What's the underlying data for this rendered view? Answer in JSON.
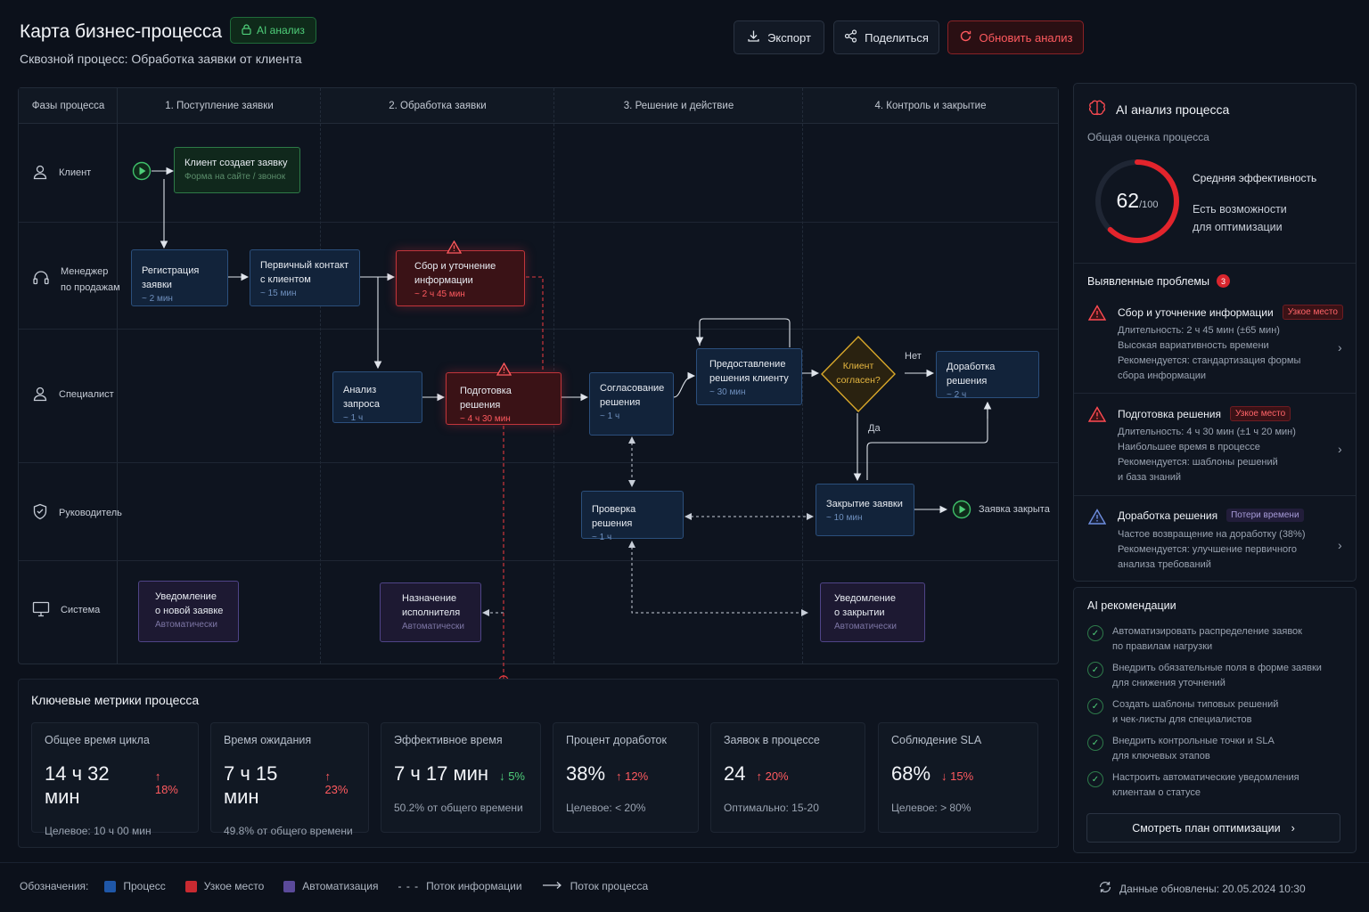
{
  "header": {
    "title": "Карта бизнес-процесса",
    "badge": "AI анализ",
    "subtitle": "Сквозной процесс: Обработка заявки от клиента",
    "export": "Экспорт",
    "share": "Поделиться",
    "refresh": "Обновить анализ"
  },
  "map": {
    "phases_label": "Фазы процесса",
    "columns": [
      "1. Поступление заявки",
      "2. Обработка заявки",
      "3. Решение и действие",
      "4. Контроль и закрытие"
    ],
    "lanes": {
      "client": "Клиент",
      "manager_1": "Менеджер",
      "manager_2": "по продажам",
      "specialist": "Специалист",
      "head": "Руководитель",
      "system": "Система"
    },
    "nodes": {
      "create": {
        "title": "Клиент создает заявку",
        "sub": "Форма на сайте / звонок"
      },
      "register": {
        "title": "Регистрация заявки",
        "sub": "~ 2 мин"
      },
      "contact": {
        "title_1": "Первичный контакт",
        "title_2": "с клиентом",
        "sub": "~ 15 мин"
      },
      "collect": {
        "title_1": "Сбор и уточнение",
        "title_2": "информации",
        "sub": "~ 2 ч 45 мин"
      },
      "analysis": {
        "title": "Анализ запроса",
        "sub": "~ 1 ч"
      },
      "prepare": {
        "title": "Подготовка решения",
        "sub": "~ 4 ч 30 мин"
      },
      "approve": {
        "title_1": "Согласование",
        "title_2": "решения",
        "sub": "~ 1 ч"
      },
      "provide": {
        "title_1": "Предоставление",
        "title_2": "решения клиенту",
        "sub": "~ 30 мин"
      },
      "decision_1": "Клиент",
      "decision_2": "согласен?",
      "no": "Нет",
      "yes": "Да",
      "rework": {
        "title": "Доработка решения",
        "sub": "~ 2 ч"
      },
      "check": {
        "title": "Проверка решения",
        "sub": "~ 1 ч"
      },
      "close": {
        "title": "Закрытие заявки",
        "sub": "~ 10 мин"
      },
      "closed": "Заявка закрыта",
      "notify_new": {
        "title_1": "Уведомление",
        "title_2": "о новой заявке",
        "sub": "Автоматически"
      },
      "assign": {
        "title_1": "Назначение",
        "title_2": "исполнителя",
        "sub": "Автоматически"
      },
      "notify_close": {
        "title_1": "Уведомление",
        "title_2": "о закрытии",
        "sub": "Автоматически"
      }
    }
  },
  "ai_panel": {
    "title": "AI анализ процесса",
    "overall": "Общая оценка процесса",
    "score": "62",
    "score_of": "/100",
    "score_fraction": 0.62,
    "eff": "Средняя эффективность",
    "opp_1": "Есть возможности",
    "opp_2": "для оптимизации",
    "problems_title": "Выявленные проблемы",
    "problems_count": "3",
    "problems": [
      {
        "title": "Сбор и уточнение информации",
        "tag": "Узкое место",
        "lines": [
          "Длительность: 2 ч 45 мин (±65 мин)",
          "Высокая вариативность времени",
          "Рекомендуется: стандартизация формы",
          "сбора информации"
        ]
      },
      {
        "title": "Подготовка решения",
        "tag": "Узкое место",
        "lines": [
          "Длительность: 4 ч 30 мин (±1 ч 20 мин)",
          "Наибольшее время в процессе",
          "Рекомендуется: шаблоны решений",
          "и база знаний"
        ]
      },
      {
        "title": "Доработка решения",
        "tag": "Потери времени",
        "lines": [
          "Частое возвращение на доработку (38%)",
          "Рекомендуется: улучшение первичного",
          "анализа требований"
        ]
      }
    ]
  },
  "recs": {
    "title": "AI рекомендации",
    "items": [
      [
        "Автоматизировать распределение заявок",
        "по правилам нагрузки"
      ],
      [
        "Внедрить обязательные поля в форме заявки",
        "для снижения уточнений"
      ],
      [
        "Создать шаблоны типовых решений",
        "и чек-листы для специалистов"
      ],
      [
        "Внедрить контрольные точки и SLA",
        "для ключевых этапов"
      ],
      [
        "Настроить автоматические уведомления",
        "клиентам о статусе"
      ]
    ],
    "plan": "Смотреть план оптимизации"
  },
  "metrics": {
    "title": "Ключевые метрики процесса",
    "cards": [
      {
        "label": "Общее время цикла",
        "value": "14 ч 32 мин",
        "delta": "↑ 18%",
        "foot": "Целевое: 10 ч 00 мин"
      },
      {
        "label": "Время ожидания",
        "value": "7 ч 15 мин",
        "delta": "↑ 23%",
        "foot": "49.8% от общего времени"
      },
      {
        "label": "Эффективное время",
        "value": "7 ч 17 мин",
        "delta": "↓ 5%",
        "foot": "50.2% от общего времени"
      },
      {
        "label": "Процент доработок",
        "value": "38%",
        "delta": "↑ 12%",
        "foot": "Целевое: < 20%"
      },
      {
        "label": "Заявок в процессе",
        "value": "24",
        "delta": "↑ 20%",
        "foot": "Оптимально: 15-20"
      },
      {
        "label": "Соблюдение SLA",
        "value": "68%",
        "delta": "↓ 15%",
        "foot": "Целевое: > 80%"
      }
    ]
  },
  "legend": {
    "title": "Обозначения:",
    "process": "Процесс",
    "bottleneck": "Узкое место",
    "automation": "Автоматизация",
    "info_flow": "Поток информации",
    "process_flow": "Поток процесса",
    "updated": "Данные обновлены: 20.05.2024 10:30"
  },
  "colors": {
    "process": "#1f57a8",
    "bottleneck": "#c92a31",
    "automation": "#5b4a9a",
    "accent_red": "#ff5a5f",
    "accent_green": "#4fcf7a"
  }
}
